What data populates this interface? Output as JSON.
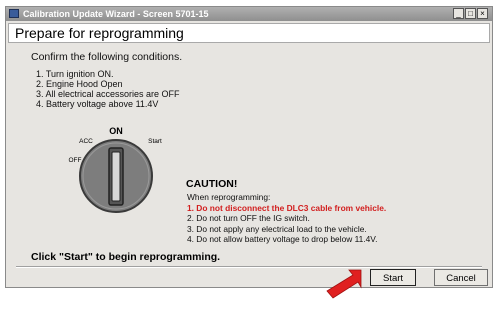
{
  "window": {
    "title": "Calibration Update Wizard - Screen 5701-15",
    "minimize_label": "_",
    "maximize_label": "□",
    "close_label": "×"
  },
  "header": {
    "title": "Prepare for reprogramming"
  },
  "intro": "Confirm the following conditions.",
  "conditions": [
    "1. Turn ignition ON.",
    "2. Engine Hood Open",
    "3. All electrical accessories are OFF",
    "4. Battery voltage above 11.4V"
  ],
  "key_switch": {
    "on": "ON",
    "acc": "ACC",
    "off": "OFF",
    "start": "Start"
  },
  "caution": {
    "title": "CAUTION!",
    "intro": "When reprogramming:",
    "items": [
      "1. Do not disconnect the DLC3 cable from vehicle.",
      "2. Do not turn OFF the IG switch.",
      "3. Do not apply any electrical load to the vehicle.",
      "4. Do not allow battery voltage to drop below 11.4V."
    ],
    "warning_color": "#d21e1e"
  },
  "instruction": "Click \"Start\" to begin reprogramming.",
  "buttons": {
    "start": "Start",
    "cancel": "Cancel"
  },
  "colors": {
    "arrow": "#e02020",
    "title_bar": "#9a9a9a",
    "dialog_bg": "#e7e5e1"
  }
}
